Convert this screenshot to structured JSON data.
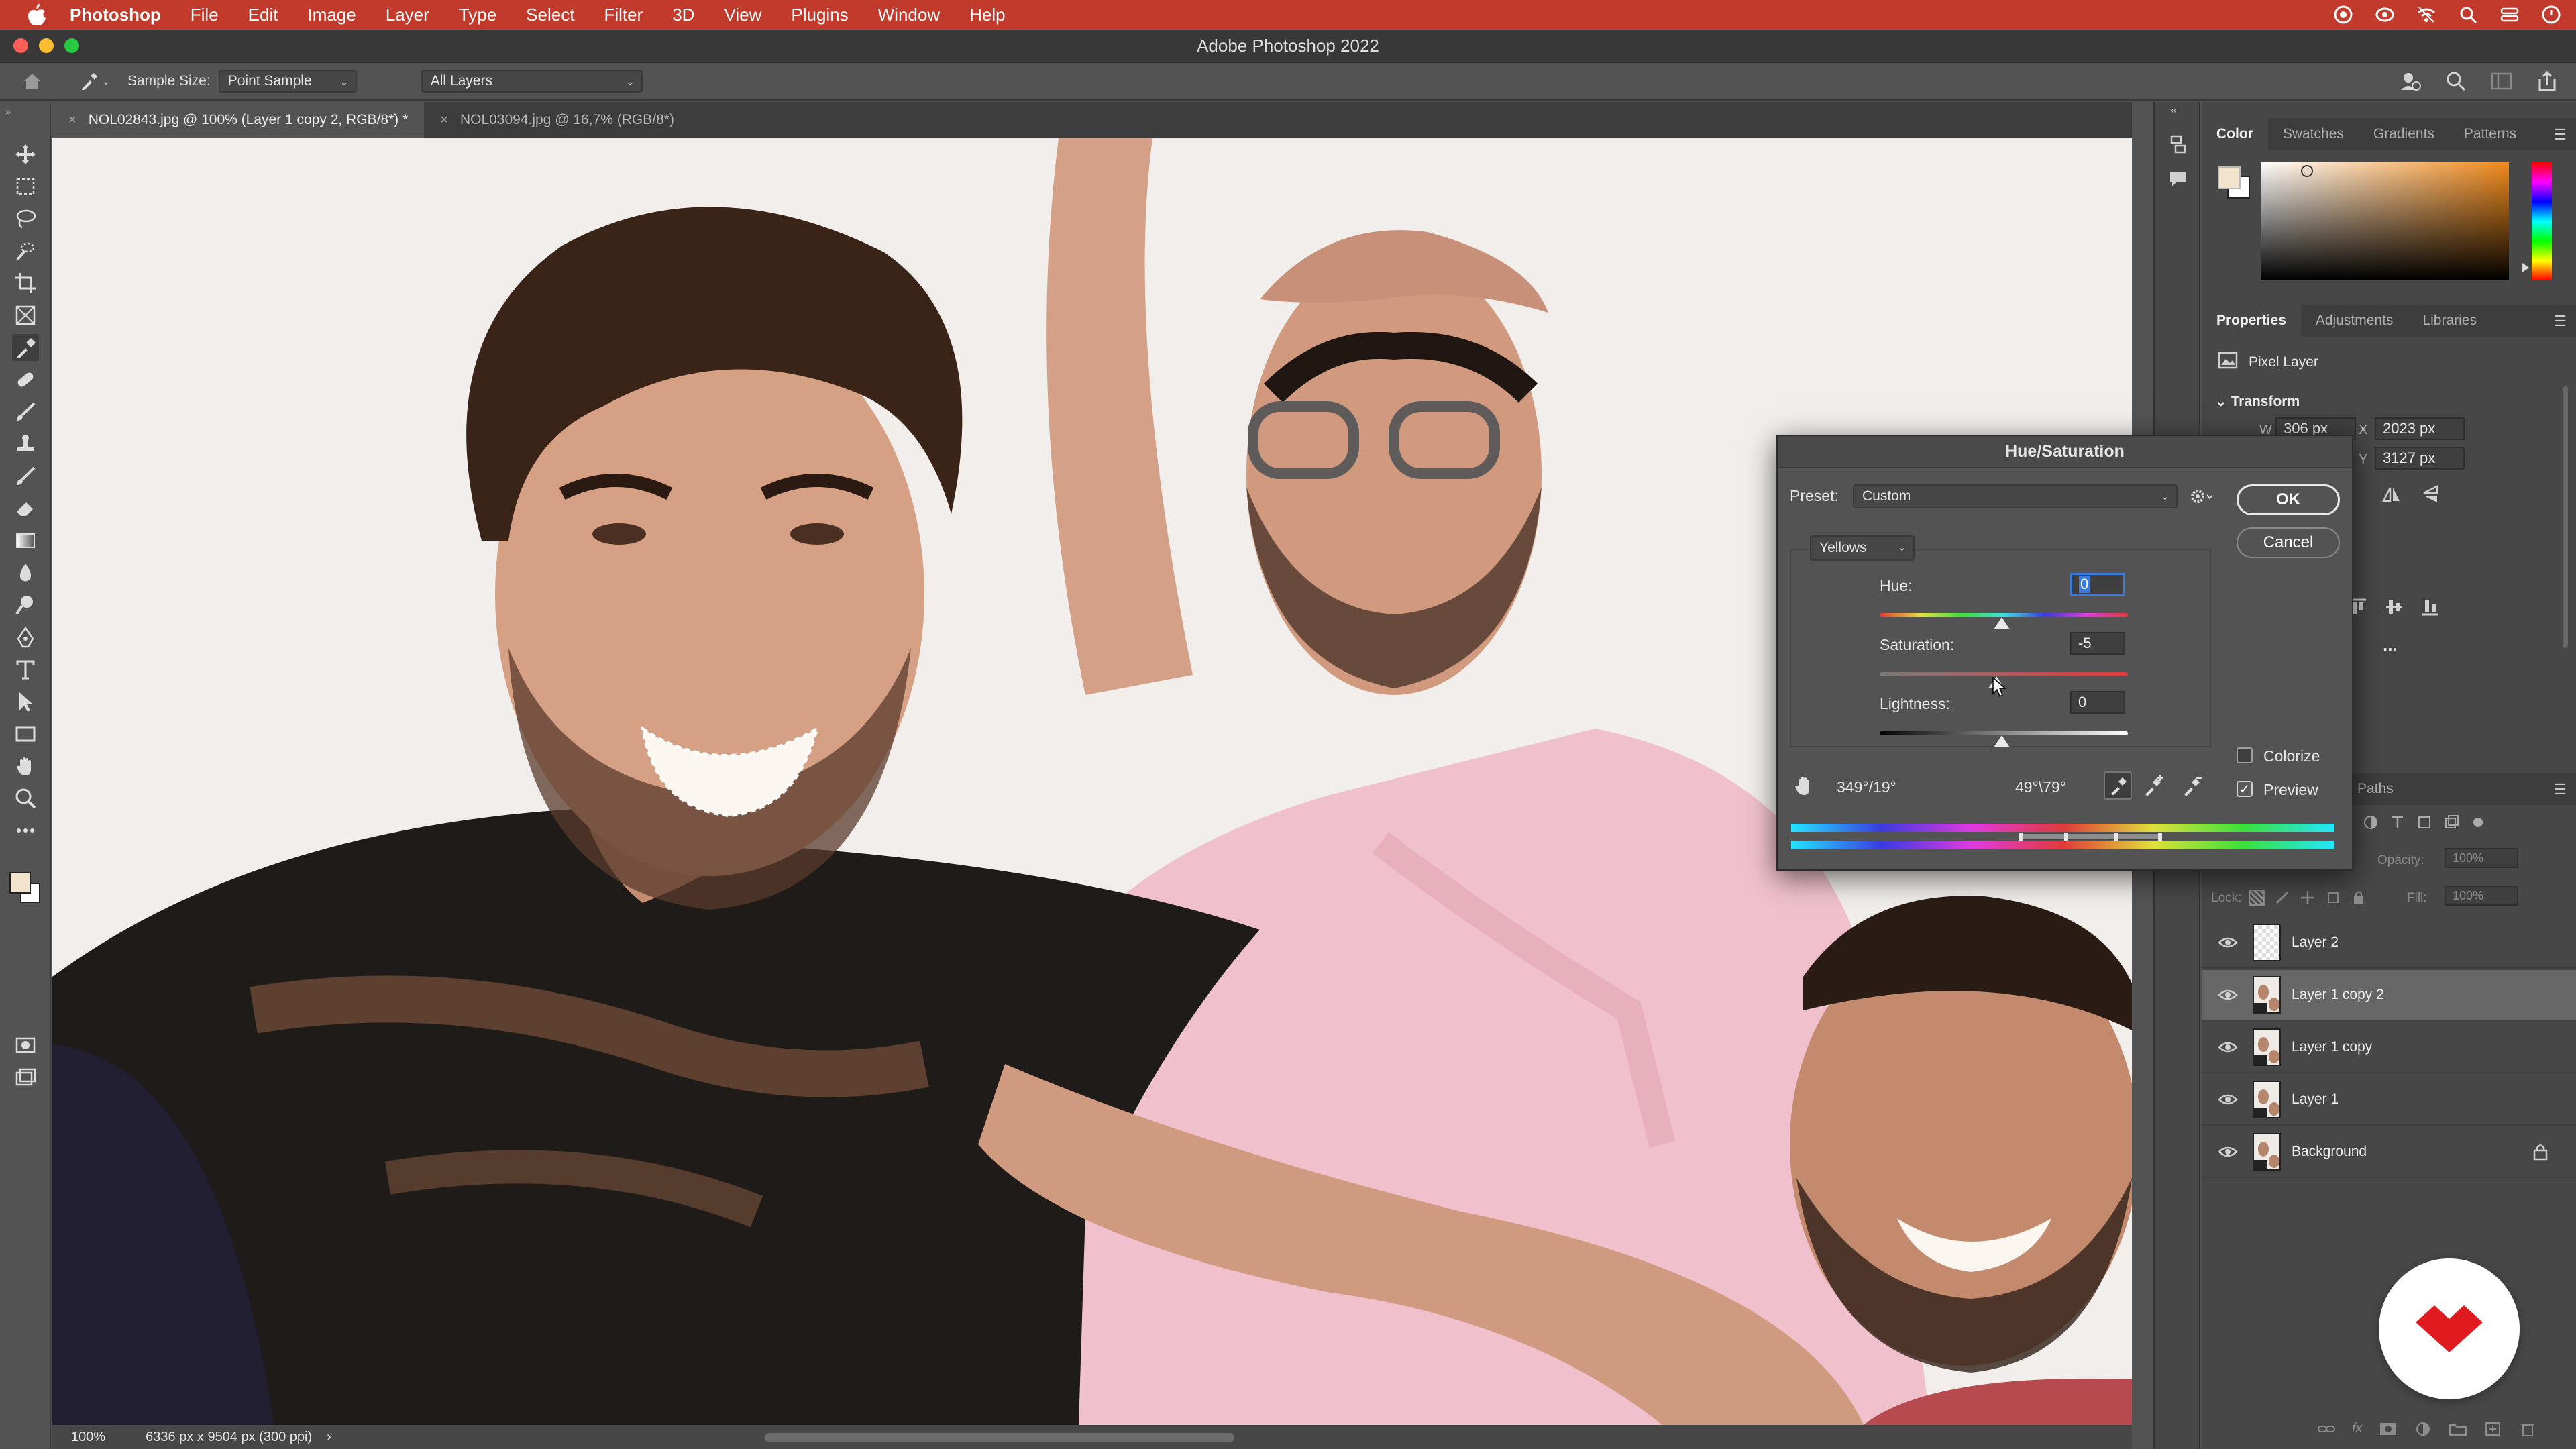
{
  "menubar": {
    "app_name": "Photoshop",
    "items": [
      "File",
      "Edit",
      "Image",
      "Layer",
      "Type",
      "Select",
      "Filter",
      "3D",
      "View",
      "Plugins",
      "Window",
      "Help"
    ],
    "right_icons": [
      "creative-cloud-icon",
      "control-center-icon",
      "wifi-icon",
      "spotlight-search-icon",
      "control-panel-icon",
      "notification-icon"
    ]
  },
  "window": {
    "title": "Adobe Photoshop 2022"
  },
  "options": {
    "sample_size_label": "Sample Size:",
    "sample_size_value": "Point Sample",
    "sample_layers_value": "All Layers"
  },
  "tabs": [
    {
      "label": "NOL02843.jpg @ 100% (Layer 1 copy 2, RGB/8*) *",
      "active": true
    },
    {
      "label": "NOL03094.jpg @ 16,7% (RGB/8*)",
      "active": false
    }
  ],
  "status": {
    "zoom": "100%",
    "doc_info": "6336 px x 9504 px (300 ppi)",
    "arrow": "›"
  },
  "color_panel": {
    "tabs": [
      "Color",
      "Swatches",
      "Gradients",
      "Patterns"
    ],
    "active_tab": "Color",
    "hue_color": "#f08a1c"
  },
  "properties_panel": {
    "tabs": [
      "Properties",
      "Adjustments",
      "Libraries"
    ],
    "active_tab": "Properties",
    "layer_type": "Pixel Layer",
    "section": "Transform",
    "w_label": "W",
    "w_value": "306 px",
    "x_label": "X",
    "x_value": "2023 px",
    "y_label": "Y",
    "y_value": "3127 px",
    "more": "..."
  },
  "layers_panel": {
    "tab_visible": "Paths",
    "opacity_label": "Opacity:",
    "opacity_value": "100%",
    "lock_label": "Lock:",
    "fill_label": "Fill:",
    "fill_value": "100%",
    "layers": [
      {
        "name": "Layer 2",
        "selected": false,
        "locked": false,
        "thumb": "blank"
      },
      {
        "name": "Layer 1 copy 2",
        "selected": true,
        "locked": false,
        "thumb": "photo"
      },
      {
        "name": "Layer 1 copy",
        "selected": false,
        "locked": false,
        "thumb": "photo"
      },
      {
        "name": "Layer 1",
        "selected": false,
        "locked": false,
        "thumb": "photo"
      },
      {
        "name": "Background",
        "selected": false,
        "locked": true,
        "thumb": "photo"
      }
    ]
  },
  "hue_saturation": {
    "title": "Hue/Saturation",
    "preset_label": "Preset:",
    "preset_value": "Custom",
    "ok_label": "OK",
    "cancel_label": "Cancel",
    "channel": "Yellows",
    "hue_label": "Hue:",
    "hue_value": "0",
    "saturation_label": "Saturation:",
    "saturation_value": "-5",
    "lightness_label": "Lightness:",
    "lightness_value": "0",
    "colorize_label": "Colorize",
    "colorize_checked": false,
    "preview_label": "Preview",
    "preview_checked": true,
    "range_left": "349°/19°",
    "range_right": "49°\\79°"
  }
}
